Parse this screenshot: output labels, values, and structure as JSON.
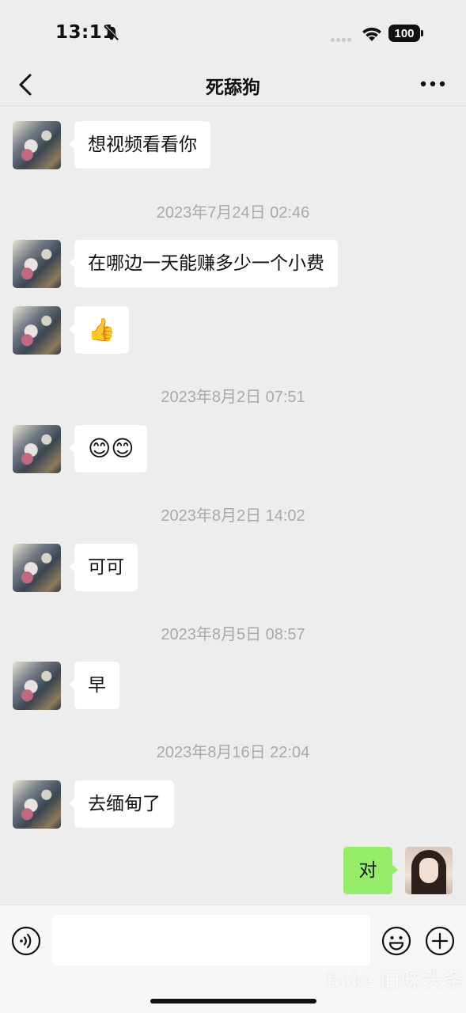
{
  "status_bar": {
    "time": "13:11",
    "battery": "100"
  },
  "nav": {
    "title": "死舔狗"
  },
  "messages": [
    {
      "text": "想视频看看你"
    },
    {
      "text": "在哪边一天能赚多少一个小费"
    },
    {
      "text": "👍"
    },
    {
      "text": "😊😊"
    },
    {
      "text": "可可"
    },
    {
      "text": "早"
    },
    {
      "text": "去缅甸了"
    }
  ],
  "timestamps": [
    "2023年7月24日 02:46",
    "2023年8月2日 07:51",
    "2023年8月2日 14:02",
    "2023年8月5日 08:57",
    "2023年8月16日 22:04"
  ],
  "outgoing": {
    "text": "对"
  },
  "input": {
    "value": ""
  },
  "watermark": "Boke 旧味头条"
}
